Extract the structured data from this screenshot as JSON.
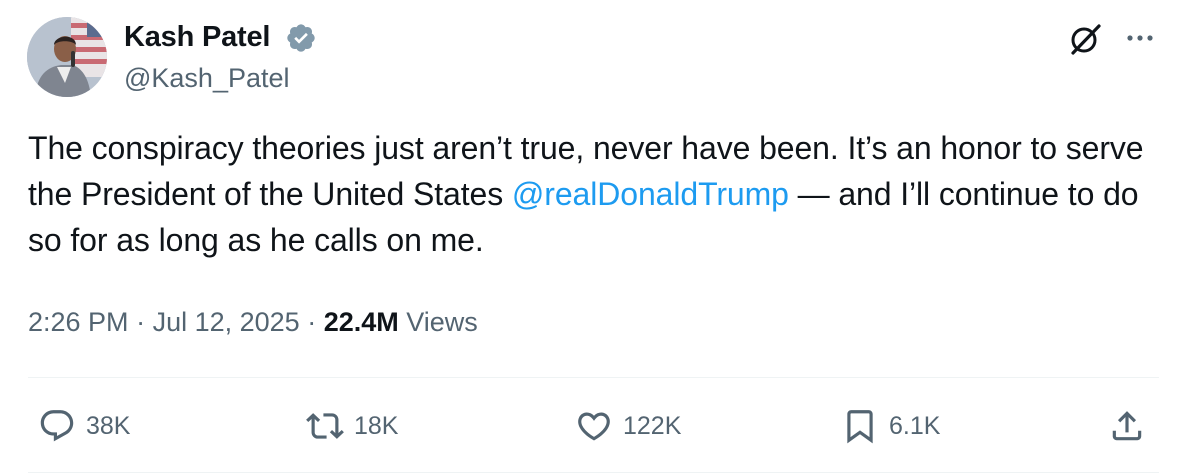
{
  "author": {
    "display_name": "Kash Patel",
    "handle": "@Kash_Patel",
    "verified": true
  },
  "tweet": {
    "text_before_mention": "The conspiracy theories just aren’t true, never have been. It’s an honor to serve the President of the United States ",
    "mention": "@realDonaldTrump",
    "text_after_mention": " — and I’ll continue to do so for as long as he calls on me."
  },
  "meta": {
    "time": "2:26 PM",
    "separator_1": " · ",
    "date": "Jul 12, 2025",
    "separator_2": " · ",
    "views_count": "22.4M",
    "views_label": " Views"
  },
  "actions": {
    "replies": "38K",
    "reposts": "18K",
    "likes": "122K",
    "bookmarks": "6.1K"
  },
  "colors": {
    "text": "#0f1419",
    "secondary_text": "#536471",
    "link": "#1d9bf0",
    "divider": "#eff3f4"
  },
  "icons": {
    "header": [
      "grok-icon",
      "more-icon"
    ],
    "actions": [
      "reply-icon",
      "repost-icon",
      "like-icon",
      "bookmark-icon",
      "share-icon"
    ]
  }
}
